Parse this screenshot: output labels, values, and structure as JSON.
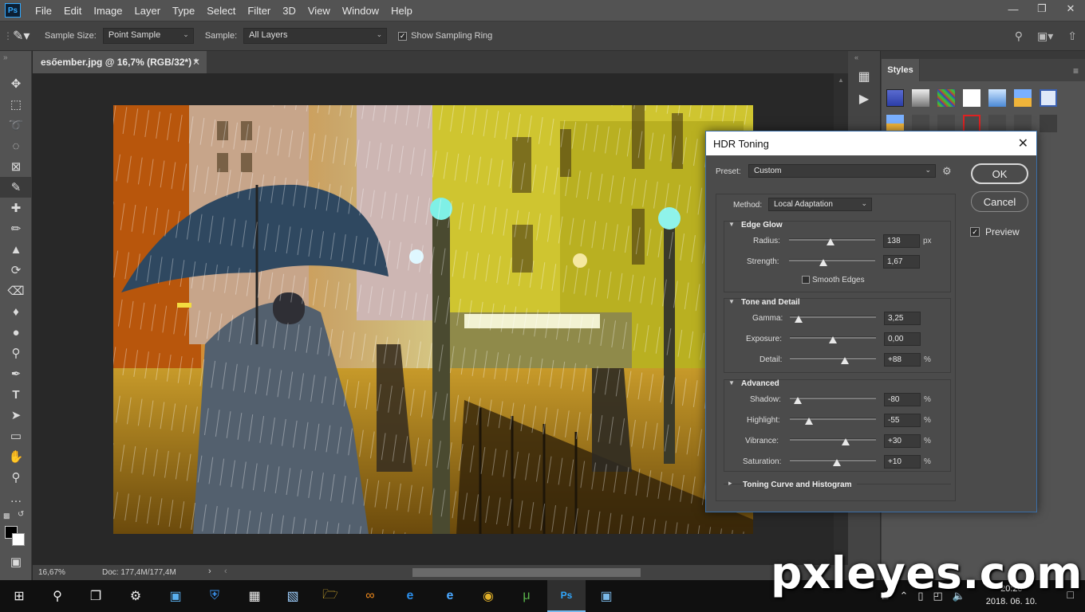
{
  "app": {
    "logo": "Ps",
    "menu": [
      "File",
      "Edit",
      "Image",
      "Layer",
      "Type",
      "Select",
      "Filter",
      "3D",
      "View",
      "Window",
      "Help"
    ]
  },
  "options": {
    "sample_size_label": "Sample Size:",
    "sample_size_value": "Point Sample",
    "sample_label": "Sample:",
    "sample_value": "All Layers",
    "sampling_ring_label": "Show Sampling Ring",
    "sampling_ring_checked": true
  },
  "document": {
    "tab_title": "esőember.jpg @ 16,7% (RGB/32*) *",
    "zoom": "16,67%",
    "doc_size": "Doc: 177,4M/177,4M"
  },
  "styles_panel": {
    "title": "Styles"
  },
  "hdr_dialog": {
    "title": "HDR Toning",
    "preset_label": "Preset:",
    "preset_value": "Custom",
    "method_label": "Method:",
    "method_value": "Local Adaptation",
    "ok_label": "OK",
    "cancel_label": "Cancel",
    "preview_label": "Preview",
    "preview_checked": true,
    "edge_glow": {
      "title": "Edge Glow",
      "radius_label": "Radius:",
      "radius_value": "138",
      "radius_unit": "px",
      "strength_label": "Strength:",
      "strength_value": "1,67",
      "smooth_edges_label": "Smooth Edges",
      "smooth_edges_checked": false
    },
    "tone_detail": {
      "title": "Tone and Detail",
      "gamma_label": "Gamma:",
      "gamma_value": "3,25",
      "exposure_label": "Exposure:",
      "exposure_value": "0,00",
      "detail_label": "Detail:",
      "detail_value": "+88",
      "detail_unit": "%"
    },
    "advanced": {
      "title": "Advanced",
      "shadow_label": "Shadow:",
      "shadow_value": "-80",
      "highlight_label": "Highlight:",
      "highlight_value": "-55",
      "vibrance_label": "Vibrance:",
      "vibrance_value": "+30",
      "saturation_label": "Saturation:",
      "saturation_value": "+10",
      "unit": "%"
    },
    "toning_curve_label": "Toning Curve and Histogram"
  },
  "taskbar": {
    "time": "20:20",
    "date": "2018. 06. 10."
  },
  "watermark": "pxleyes.com"
}
